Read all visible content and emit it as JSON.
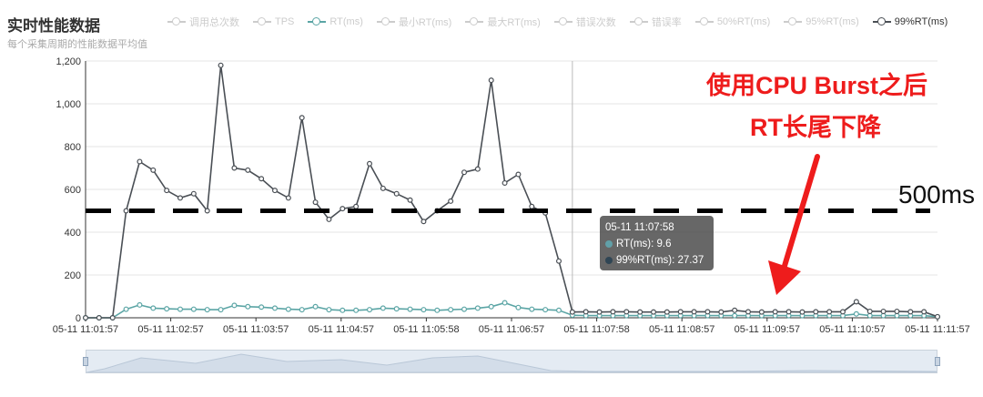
{
  "title": "实时性能数据",
  "subtitle": "每个采集周期的性能数据平均值",
  "legend": [
    {
      "label": "调用总次数",
      "active": false
    },
    {
      "label": "TPS",
      "active": false
    },
    {
      "label": "RT(ms)",
      "active": true
    },
    {
      "label": "最小RT(ms)",
      "active": false
    },
    {
      "label": "最大RT(ms)",
      "active": false
    },
    {
      "label": "错误次数",
      "active": false
    },
    {
      "label": "错误率",
      "active": false
    },
    {
      "label": "50%RT(ms)",
      "active": false
    },
    {
      "label": "95%RT(ms)",
      "active": false
    },
    {
      "label": "99%RT(ms)",
      "active": true
    }
  ],
  "annotation": {
    "line1": "使用CPU Burst之后",
    "line2": "RT长尾下降",
    "threshold_label": "500ms"
  },
  "tooltip": {
    "time": "05-11 11:07:58",
    "rows": [
      {
        "label": "RT(ms): 9.6",
        "color": "#61a0a8"
      },
      {
        "label": "99%RT(ms): 27.37",
        "color": "#2f4554"
      }
    ]
  },
  "chart_data": {
    "type": "line",
    "title": "实时性能数据",
    "ylim": [
      0,
      1200
    ],
    "yticks": [
      "0",
      "200",
      "400",
      "600",
      "800",
      "1,000",
      "1,200"
    ],
    "xticks": [
      "05-11 11:01:57",
      "05-11 11:02:57",
      "05-11 11:03:57",
      "05-11 11:04:57",
      "05-11 11:05:58",
      "05-11 11:06:57",
      "05-11 11:07:58",
      "05-11 11:08:57",
      "05-11 11:09:57",
      "05-11 11:10:57",
      "05-11 11:11:57"
    ],
    "threshold": 500,
    "grid": true,
    "series": [
      {
        "name": "RT(ms)",
        "color": "#5ba5a5",
        "values": [
          0,
          0,
          0,
          40,
          60,
          45,
          42,
          40,
          40,
          38,
          38,
          58,
          52,
          50,
          45,
          40,
          38,
          52,
          38,
          35,
          35,
          38,
          45,
          42,
          40,
          38,
          35,
          38,
          40,
          45,
          52,
          70,
          48,
          40,
          38,
          35,
          12,
          10,
          10,
          10,
          10,
          10,
          10,
          10,
          10,
          10,
          10,
          10,
          10,
          10,
          10,
          10,
          10,
          10,
          10,
          10,
          10,
          18,
          10,
          10,
          10,
          10,
          10,
          5
        ]
      },
      {
        "name": "99%RT(ms)",
        "color": "#4a4f55",
        "values": [
          0,
          0,
          0,
          500,
          730,
          690,
          595,
          560,
          580,
          500,
          1180,
          700,
          690,
          650,
          595,
          560,
          935,
          540,
          460,
          510,
          520,
          720,
          605,
          580,
          550,
          450,
          500,
          545,
          680,
          695,
          1110,
          630,
          670,
          520,
          490,
          265,
          27,
          28,
          27,
          28,
          28,
          27,
          27,
          27,
          28,
          28,
          28,
          27,
          35,
          28,
          27,
          28,
          28,
          27,
          28,
          28,
          28,
          75,
          30,
          30,
          30,
          28,
          28,
          5
        ]
      }
    ]
  }
}
